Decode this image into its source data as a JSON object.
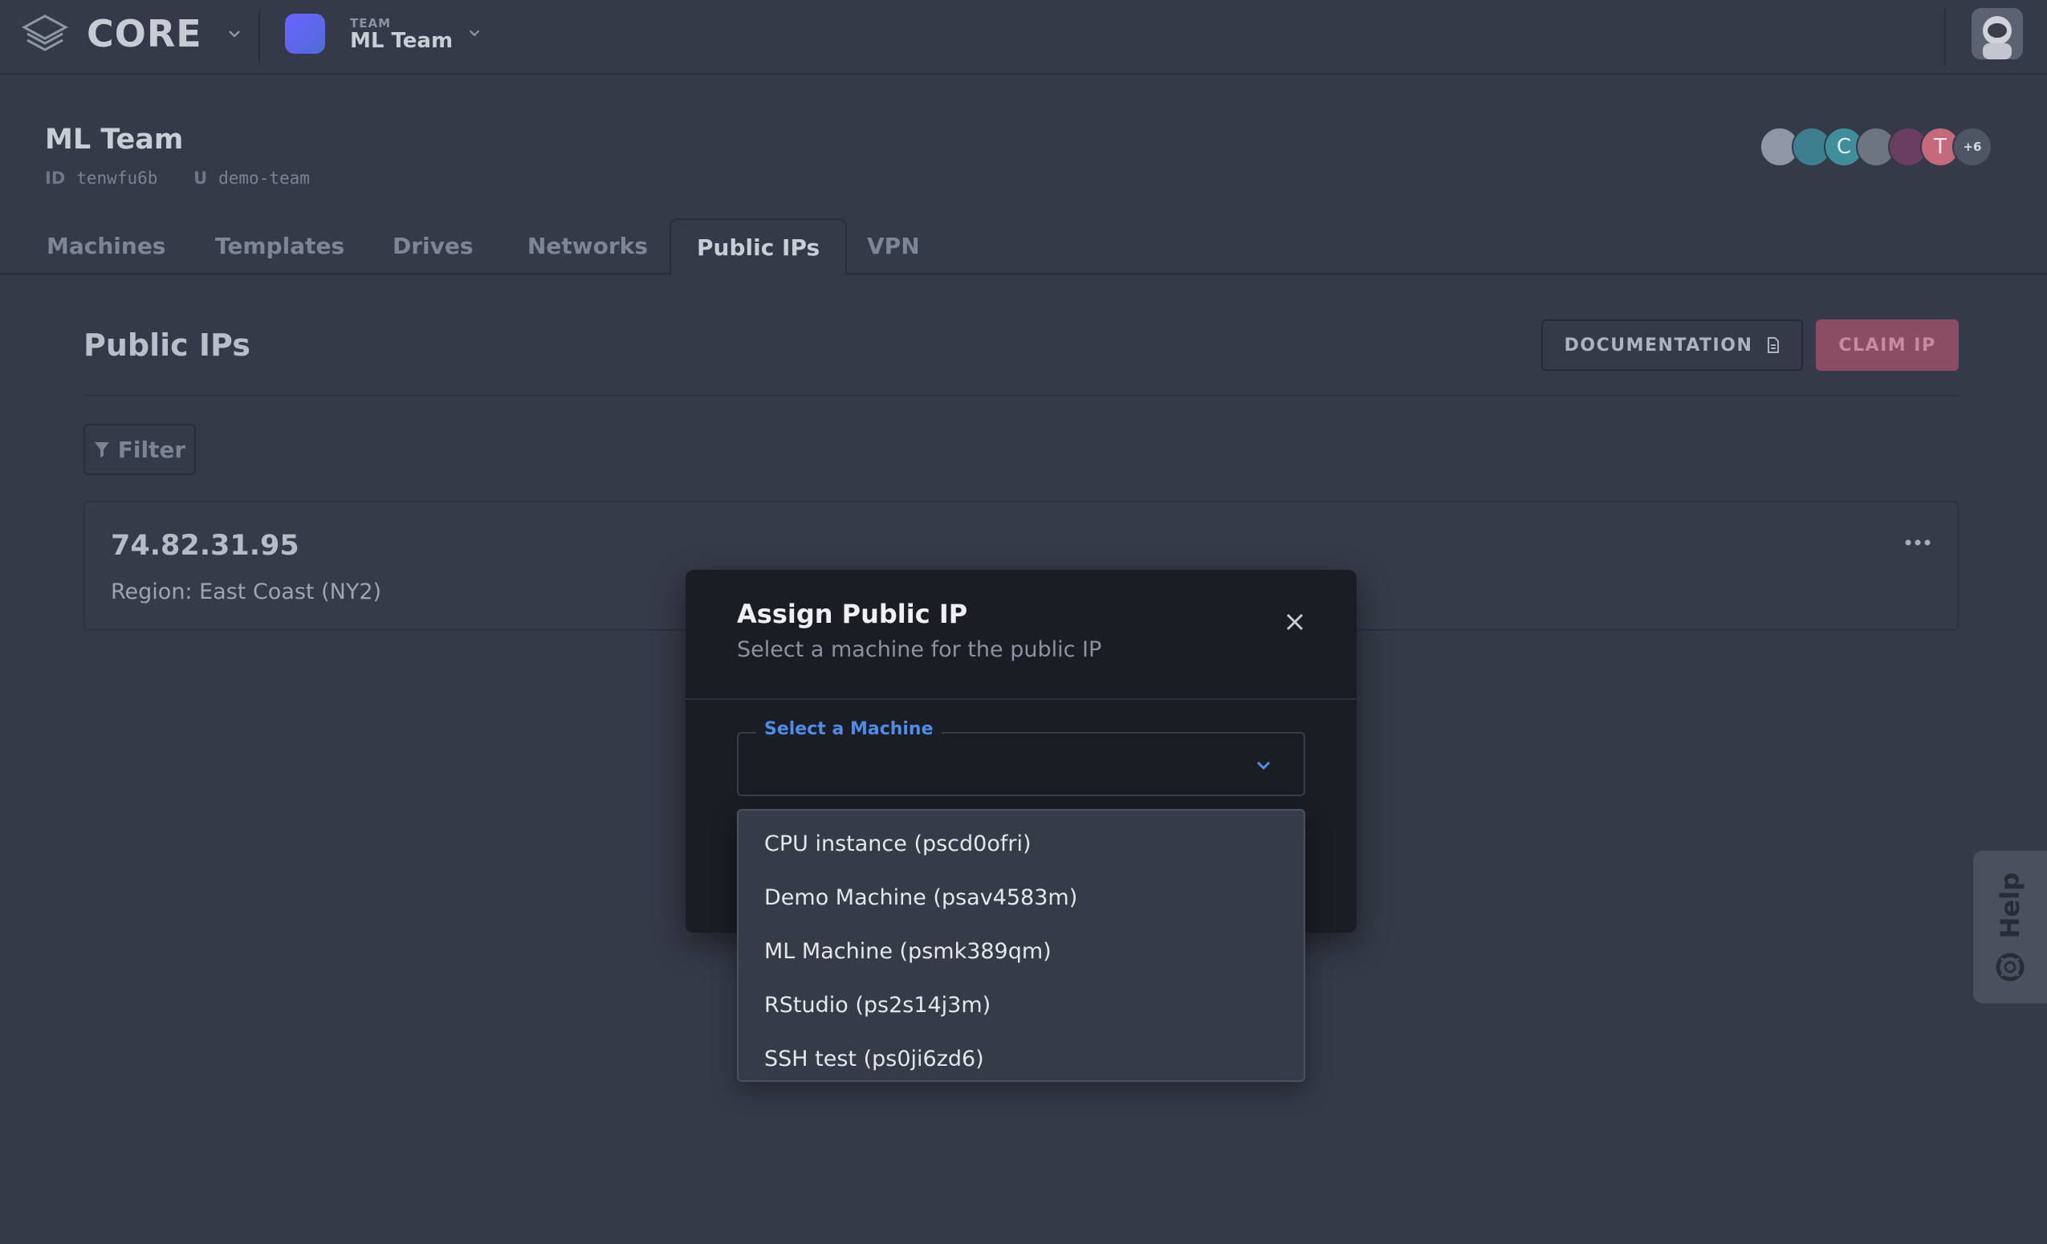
{
  "app": {
    "logo_text": "CORE",
    "team_label": "TEAM",
    "team_name": "ML Team"
  },
  "team": {
    "title": "ML Team",
    "id_key": "ID",
    "id_value": "tenwfu6b",
    "u_key": "U",
    "u_value": "demo-team",
    "member_initials": [
      "",
      "",
      "C",
      "",
      "",
      "T"
    ],
    "member_colors": [
      "#8f97a7",
      "#3d7f8f",
      "#3f8f9a",
      "#6d7482",
      "#6a3d62",
      "#c56a7d"
    ],
    "more_members": "+6"
  },
  "tabs": [
    {
      "label": "Machines"
    },
    {
      "label": "Templates"
    },
    {
      "label": "Drives"
    },
    {
      "label": "Networks"
    },
    {
      "label": "Public IPs",
      "active": true
    },
    {
      "label": "VPN"
    }
  ],
  "section": {
    "title": "Public IPs",
    "documentation_label": "DOCUMENTATION",
    "claim_label": "CLAIM IP",
    "filter_label": "Filter"
  },
  "ips": [
    {
      "address": "74.82.31.95",
      "region": "Region: East Coast (NY2)"
    }
  ],
  "modal": {
    "title": "Assign Public IP",
    "subtitle": "Select a machine for the public IP",
    "select_label": "Select a Machine",
    "selected_value": ""
  },
  "machines": [
    "CPU instance (pscd0ofri)",
    "Demo Machine (psav4583m)",
    "ML Machine (psmk389qm)",
    "RStudio (ps2s14j3m)",
    "SSH test (ps0ji6zd6)"
  ],
  "help": {
    "label": "Help"
  },
  "colors": {
    "background": "#343a47",
    "modal": "#1a1d24",
    "accent": "#4d8de8",
    "claim": "#8a4d63"
  }
}
